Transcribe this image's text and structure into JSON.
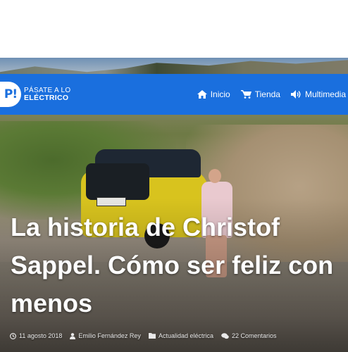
{
  "header": {
    "logo": {
      "line1": "PÁSATE A LO",
      "line2": "ELÉCTRICO",
      "mark": "P!"
    },
    "nav": [
      {
        "label": "Inicio",
        "icon": "home-icon"
      },
      {
        "label": "Tienda",
        "icon": "cart-icon"
      },
      {
        "label": "Multimedia",
        "icon": "speaker-icon"
      }
    ],
    "bg_color": "#1a6fde"
  },
  "article": {
    "title": "La historia de Christof Sappel. Cómo ser feliz con menos",
    "date": "11 agosto 2018",
    "author": "Emilio Fernández Rey",
    "category": "Actualidad eléctrica",
    "comments": "22 Comentarios"
  }
}
